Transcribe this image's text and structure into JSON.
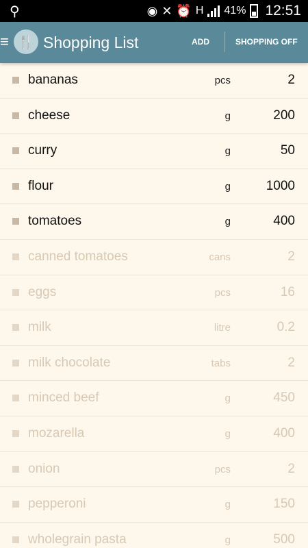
{
  "status_bar": {
    "battery": "41%",
    "time": "12:51",
    "network": "H"
  },
  "app": {
    "title": "Shopping List",
    "add_label": "ADD",
    "shopping_label": "SHOPPING OFF"
  },
  "items": [
    {
      "name": "bananas",
      "unit": "pcs",
      "qty": "2",
      "checked": false
    },
    {
      "name": "cheese",
      "unit": "g",
      "qty": "200",
      "checked": false
    },
    {
      "name": "curry",
      "unit": "g",
      "qty": "50",
      "checked": false
    },
    {
      "name": "flour",
      "unit": "g",
      "qty": "1000",
      "checked": false
    },
    {
      "name": "tomatoes",
      "unit": "g",
      "qty": "400",
      "checked": false
    },
    {
      "name": "canned tomatoes",
      "unit": "cans",
      "qty": "2",
      "checked": true
    },
    {
      "name": "eggs",
      "unit": "pcs",
      "qty": "16",
      "checked": true
    },
    {
      "name": "milk",
      "unit": "litre",
      "qty": "0.2",
      "checked": true
    },
    {
      "name": "milk chocolate",
      "unit": "tabs",
      "qty": "2",
      "checked": true
    },
    {
      "name": "minced beef",
      "unit": "g",
      "qty": "450",
      "checked": true
    },
    {
      "name": "mozarella",
      "unit": "g",
      "qty": "400",
      "checked": true
    },
    {
      "name": "onion",
      "unit": "pcs",
      "qty": "2",
      "checked": true
    },
    {
      "name": "pepperoni",
      "unit": "g",
      "qty": "150",
      "checked": true
    },
    {
      "name": "wholegrain pasta",
      "unit": "g",
      "qty": "500",
      "checked": true
    }
  ],
  "colors": {
    "action_bar": "#5a8a99",
    "background": "#fdf7ec",
    "checked_text": "#d8c9b5"
  }
}
